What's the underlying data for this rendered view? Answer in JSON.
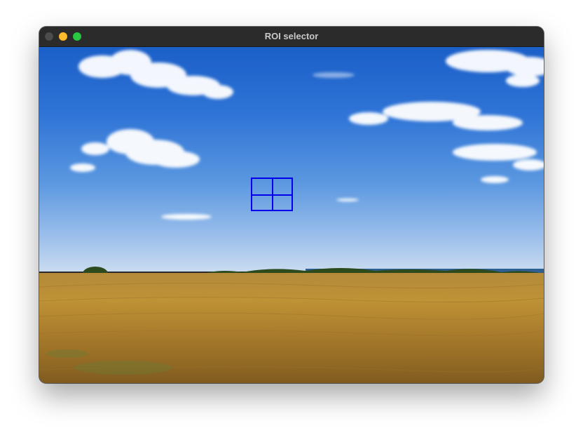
{
  "window": {
    "title": "ROI selector"
  },
  "traffic_lights": {
    "close": "traffic-close",
    "minimize": "traffic-minimize",
    "maximize": "traffic-maximize"
  },
  "colors": {
    "roi_stroke": "#0000ee",
    "sky_top": "#1b5fc8",
    "field": "#bf9236"
  },
  "roi": {
    "grid": "2x2"
  }
}
